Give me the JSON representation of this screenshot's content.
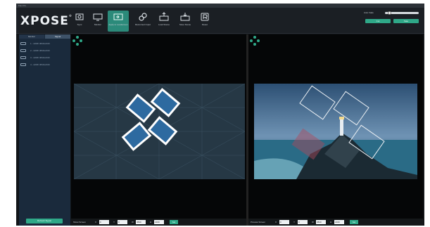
{
  "app": {
    "title": "Flex Pro",
    "logo": "XPOSE",
    "logo_mark": "®"
  },
  "toolbar": {
    "tools": [
      {
        "id": "sync",
        "label": "Sync",
        "icon": "sync-icon"
      },
      {
        "id": "monitor",
        "label": "Monitor",
        "icon": "monitor-icon"
      },
      {
        "id": "apply",
        "label": "Apply to Leadscreen",
        "icon": "apply-icon"
      },
      {
        "id": "link",
        "label": "Reconnect Input",
        "icon": "link-icon"
      },
      {
        "id": "load",
        "label": "Load Scene",
        "icon": "load-scene-icon"
      },
      {
        "id": "save",
        "label": "Save Scene",
        "icon": "save-scene-icon"
      },
      {
        "id": "reset",
        "label": "Reset",
        "icon": "reset-icon"
      }
    ],
    "active_tool": "apply"
  },
  "autofade": {
    "label": "Auto Fade",
    "button_left": "Cut",
    "button_right": "Take",
    "level": 0.1
  },
  "left_panel": {
    "tabs": [
      {
        "label": "Monitor"
      },
      {
        "label": "Signal"
      }
    ],
    "selected_tab": 1,
    "inputs": [
      {
        "label": "1 - HDMI 3840x2160"
      },
      {
        "label": "2 - HDMI 3840x2160"
      },
      {
        "label": "3 - HDMI 3840x2160"
      },
      {
        "label": "4 - HDMI 3840x2160"
      }
    ],
    "refresh_label": "Refresh Signal"
  },
  "preview": {
    "bottom": {
      "label": "Show Screen",
      "fields": [
        {
          "key": "X",
          "value": "0"
        },
        {
          "key": "Y",
          "value": "0"
        },
        {
          "key": "W",
          "value": "3840"
        },
        {
          "key": "H",
          "value": "2160"
        }
      ],
      "go": "Set"
    }
  },
  "program": {
    "bottom": {
      "label": "Preview Screen",
      "fields": [
        {
          "key": "X",
          "value": "0"
        },
        {
          "key": "Y",
          "value": "0"
        },
        {
          "key": "W",
          "value": "3840"
        },
        {
          "key": "H",
          "value": "2160"
        }
      ],
      "go": "Set"
    }
  },
  "colors": {
    "accent": "#2fa888",
    "panel": "#1a2a3c",
    "toolbar": "#1b1f24"
  }
}
